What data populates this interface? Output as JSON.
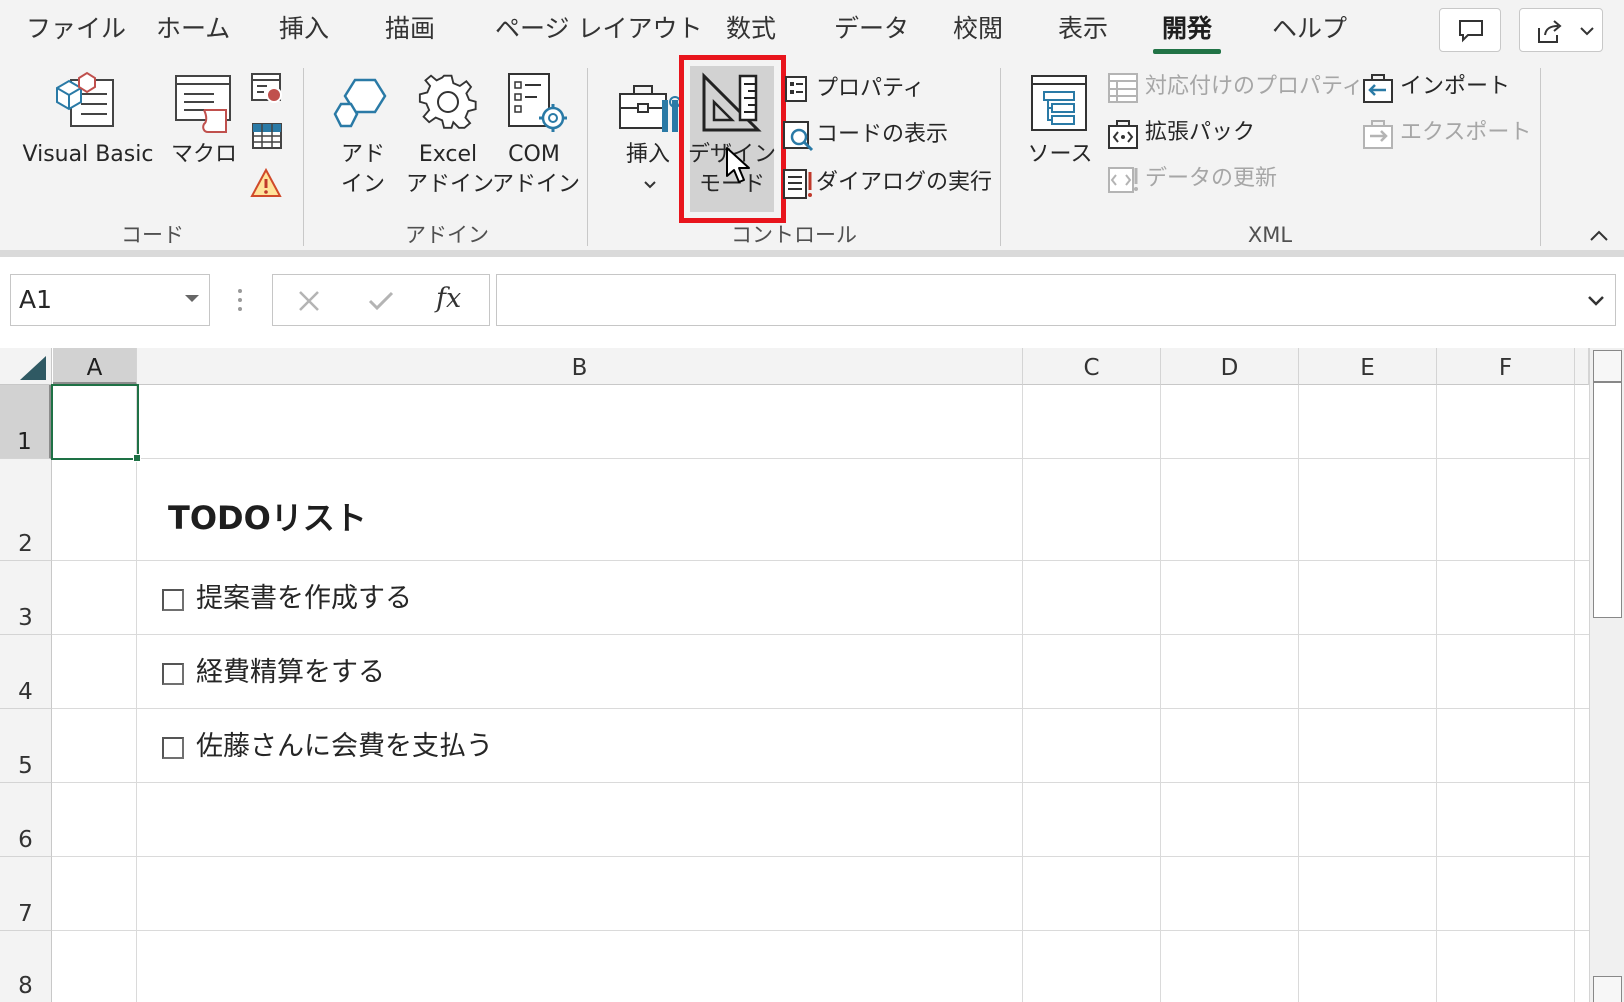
{
  "ribbon": {
    "tabs": [
      {
        "label": "ファイル"
      },
      {
        "label": "ホーム"
      },
      {
        "label": "挿入"
      },
      {
        "label": "描画"
      },
      {
        "label": "ページ レイアウト"
      },
      {
        "label": "数式"
      },
      {
        "label": "データ"
      },
      {
        "label": "校閲"
      },
      {
        "label": "表示"
      },
      {
        "label": "開発",
        "active": true
      },
      {
        "label": "ヘルプ"
      }
    ],
    "groups": {
      "code": {
        "label": "コード",
        "visual_basic": "Visual Basic",
        "macro": "マクロ"
      },
      "addins": {
        "label": "アドイン",
        "addin_1": "アド",
        "addin_2": "イン",
        "excel_addin_1": "Excel",
        "excel_addin_2": "アドイン",
        "com_addin_1": "COM",
        "com_addin_2": "アドイン"
      },
      "controls": {
        "label": "コントロール",
        "insert": "挿入",
        "design_mode_1": "デザイン",
        "design_mode_2": "モード",
        "properties": "プロパティ",
        "view_code": "コードの表示",
        "run_dialog": "ダイアログの実行"
      },
      "xml": {
        "label": "XML",
        "source": "ソース",
        "map_properties": "対応付けのプロパティ",
        "expansion_packs": "拡張パック",
        "refresh_data": "データの更新",
        "import": "インポート",
        "export": "エクスポート"
      }
    },
    "accent_color": "#217346",
    "highlight_color": "#e8141c"
  },
  "formula_bar": {
    "name_box": "A1",
    "fx_label": "fx",
    "formula": ""
  },
  "sheet": {
    "columns": [
      "A",
      "B",
      "C",
      "D",
      "E",
      "F"
    ],
    "rows": [
      "1",
      "2",
      "3",
      "4",
      "5",
      "6",
      "7",
      "8"
    ],
    "title": "TODOリスト",
    "todos": [
      {
        "text": "提案書を作成する",
        "checked": false
      },
      {
        "text": "経費精算をする",
        "checked": false
      },
      {
        "text": "佐藤さんに会費を支払う",
        "checked": false
      }
    ]
  }
}
